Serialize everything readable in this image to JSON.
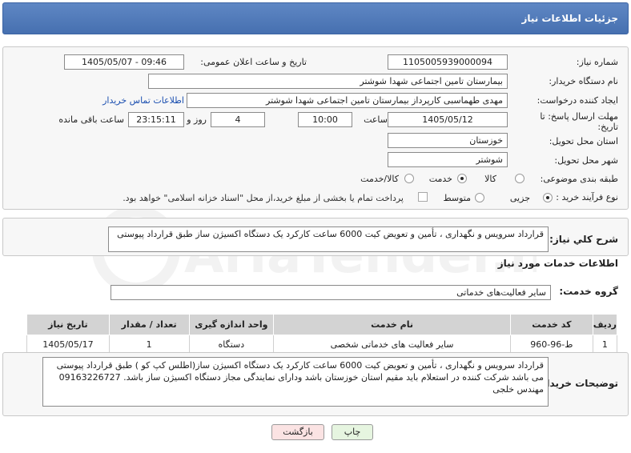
{
  "header": {
    "title": "جزئیات اطلاعات نیاز"
  },
  "form": {
    "need_number_label": "شماره نیاز:",
    "need_number": "1105005939000094",
    "announce_label": "تاریخ و ساعت اعلان عمومی:",
    "announce_value": "1405/05/07 - 09:46",
    "buyer_org_label": "نام دستگاه خریدار:",
    "buyer_org": "بیمارستان تامین اجتماعی شهدا شوشتر",
    "creator_label": "ایجاد کننده درخواست:",
    "creator": "مهدی طهماسبی کارپرداز بیمارستان تامین اجتماعی شهدا شوشتر",
    "contact_link": "اطلاعات تماس خریدار",
    "deadline_label": "مهلت ارسال پاسخ: تا تاریخ:",
    "deadline_date": "1405/05/12",
    "time_label": "ساعت",
    "deadline_time": "10:00",
    "days_value": "4",
    "days_label": "روز و",
    "remaining_time": "23:15:11",
    "remaining_label": "ساعت باقی مانده",
    "province_label": "استان محل تحویل:",
    "province": "خوزستان",
    "city_label": "شهر محل تحویل:",
    "city": "شوشتر",
    "category_label": "طبقه بندی موضوعی:",
    "category_options": [
      "کالا",
      "خدمت",
      "کالا/خدمت"
    ],
    "category_selected": "خدمت",
    "process_label": "نوع فرآیند خرید :",
    "process_options": [
      "جزیی",
      "متوسط"
    ],
    "process_selected": "جزیی",
    "payment_note": "پرداخت تمام یا بخشی از مبلغ خرید،از محل \"اسناد خزانه اسلامی\" خواهد بود."
  },
  "summary": {
    "label": "شرح کلي نياز:",
    "text": "قرارداد سرویس و نگهداری ، تأمین و تعویض کیت 6000 ساعت کارکرد یک دستگاه اکسیژن ساز طبق قرارداد پیوستی"
  },
  "services": {
    "section_title": "اطلاعات خدمات مورد نیاز",
    "group_label": "گروه خدمت:",
    "group_value": "سایر فعالیت‌های خدماتی",
    "columns": [
      "ردیف",
      "کد خدمت",
      "نام خدمت",
      "واحد اندازه گیری",
      "تعداد / مقدار",
      "تاریخ نیاز"
    ],
    "rows": [
      {
        "row": "1",
        "code": "ط-96-960",
        "name": "سایر فعالیت های خدماتی شخصی",
        "unit": "دستگاه",
        "qty": "1",
        "date": "1405/05/17"
      }
    ]
  },
  "buyer_notes": {
    "label": "توضیحات خریدار:",
    "text": "قرارداد سرویس و نگهداری ، تأمین و تعویض کیت 6000 ساعت کارکرد یک دستگاه اکسیژن ساز(اطلس کپ کو ) طبق قرارداد پیوستی می باشد شرکت کننده در استعلام باید مقیم استان خوزستان باشد ودارای نمایندگی مجاز دستگاه اکسیژن ساز باشد. 09163226727 مهندس خلجی"
  },
  "buttons": {
    "print": "چاپ",
    "back": "بازگشت"
  },
  "watermark": "AriaTender.net",
  "colors": {
    "header": "#4f78ba",
    "link": "#1b4fb0",
    "print_btn": "#e6f5e0",
    "back_btn": "#fbe3e3"
  }
}
